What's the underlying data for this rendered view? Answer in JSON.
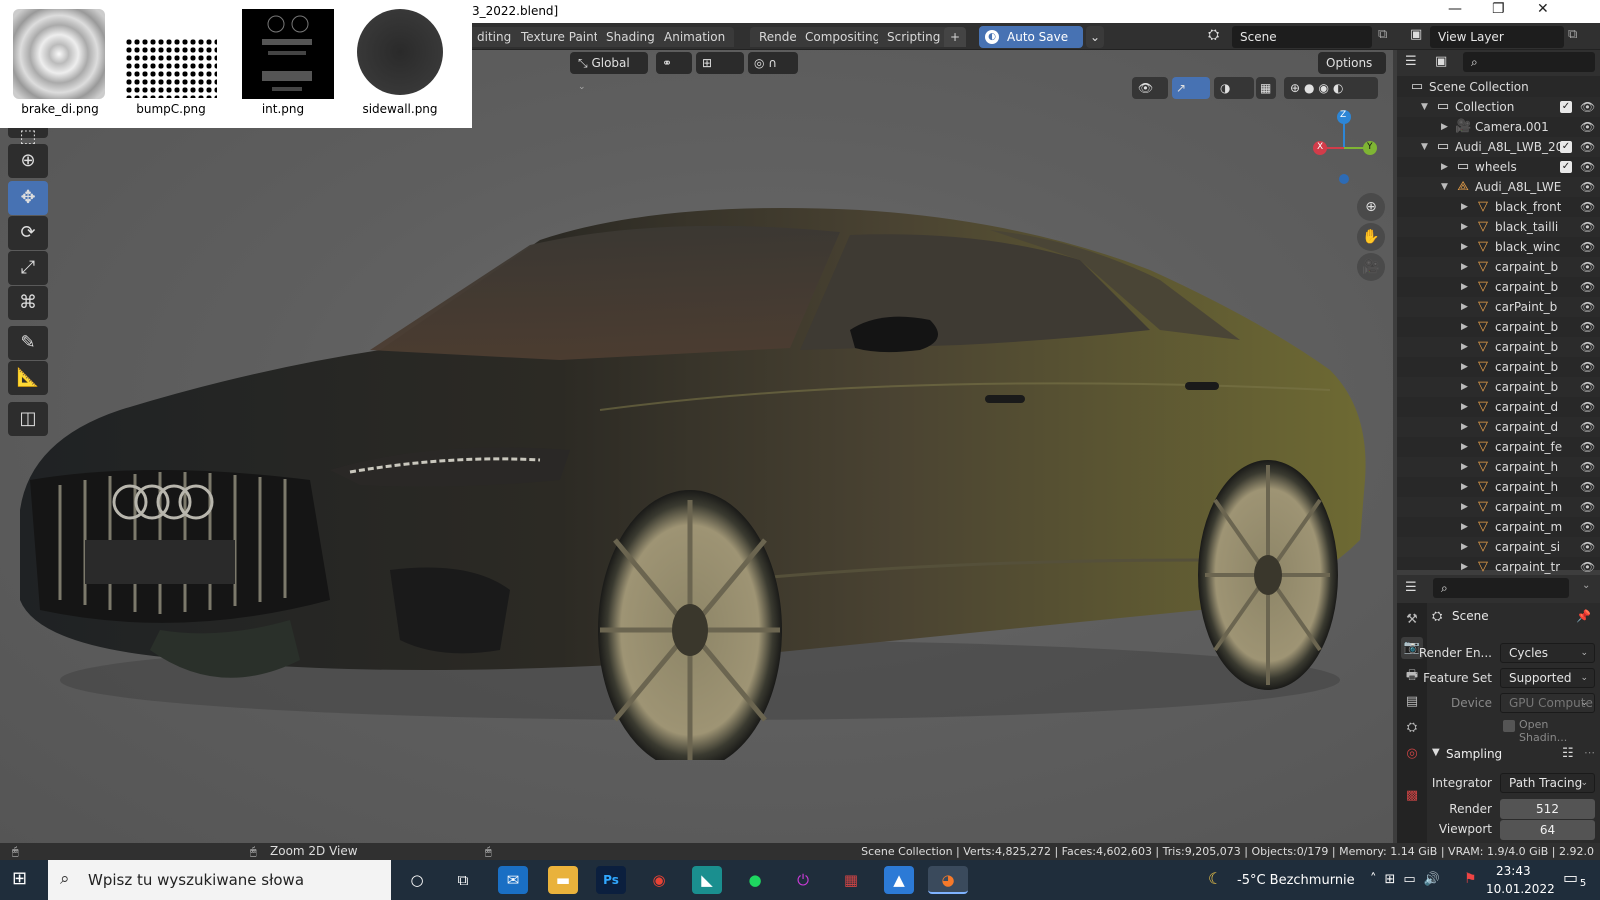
{
  "window": {
    "title": "3_2022.blend]",
    "minimize": "—",
    "maximize": "❐",
    "close": "✕"
  },
  "workspace_tabs": [
    "diting",
    "Texture Paint",
    "Shading",
    "Animation",
    "Rendering",
    "Compositing",
    "Scripting",
    "+"
  ],
  "auto_save": "Auto Save",
  "scene_field": "Scene",
  "view_layer_field": "View Layer",
  "viewport": {
    "transform_orientation": "Global",
    "options": "Options",
    "tool_hint": "Zoom 2D View",
    "gizmo": {
      "x": "X",
      "y": "Y",
      "z": "Z"
    }
  },
  "thumbnails": [
    "brake_di.png",
    "bumpC.png",
    "int.png",
    "sidewall.png"
  ],
  "outliner": {
    "root": "Scene Collection",
    "items": [
      {
        "label": "Collection",
        "depth": 1,
        "icon": "collection-icon",
        "expanded": true,
        "check": true
      },
      {
        "label": "Camera.001",
        "depth": 2,
        "icon": "camera-icon",
        "expanded": false
      },
      {
        "label": "Audi_A8L_LWB_20",
        "depth": 1,
        "icon": "collection-icon",
        "expanded": true,
        "check": true
      },
      {
        "label": "wheels",
        "depth": 2,
        "icon": "collection-icon",
        "expanded": false,
        "check": true
      },
      {
        "label": "Audi_A8L_LWE",
        "depth": 2,
        "icon": "armature-icon",
        "expanded": true
      },
      {
        "label": "black_front",
        "depth": 3,
        "icon": "mesh-icon",
        "expanded": false
      },
      {
        "label": "black_tailli",
        "depth": 3,
        "icon": "mesh-icon",
        "expanded": false
      },
      {
        "label": "black_winc",
        "depth": 3,
        "icon": "mesh-icon",
        "expanded": false
      },
      {
        "label": "carpaint_b",
        "depth": 3,
        "icon": "mesh-icon",
        "expanded": false
      },
      {
        "label": "carpaint_b",
        "depth": 3,
        "icon": "mesh-icon",
        "expanded": false
      },
      {
        "label": "carPaint_b",
        "depth": 3,
        "icon": "mesh-icon",
        "expanded": false
      },
      {
        "label": "carpaint_b",
        "depth": 3,
        "icon": "mesh-icon",
        "expanded": false
      },
      {
        "label": "carpaint_b",
        "depth": 3,
        "icon": "mesh-icon",
        "expanded": false
      },
      {
        "label": "carpaint_b",
        "depth": 3,
        "icon": "mesh-icon",
        "expanded": false
      },
      {
        "label": "carpaint_b",
        "depth": 3,
        "icon": "mesh-icon",
        "expanded": false
      },
      {
        "label": "carpaint_d",
        "depth": 3,
        "icon": "mesh-icon",
        "expanded": false
      },
      {
        "label": "carpaint_d",
        "depth": 3,
        "icon": "mesh-icon",
        "expanded": false
      },
      {
        "label": "carpaint_fe",
        "depth": 3,
        "icon": "mesh-icon",
        "expanded": false
      },
      {
        "label": "carpaint_h",
        "depth": 3,
        "icon": "mesh-icon",
        "expanded": false
      },
      {
        "label": "carpaint_h",
        "depth": 3,
        "icon": "mesh-icon",
        "expanded": false
      },
      {
        "label": "carpaint_m",
        "depth": 3,
        "icon": "mesh-icon",
        "expanded": false
      },
      {
        "label": "carpaint_m",
        "depth": 3,
        "icon": "mesh-icon",
        "expanded": false
      },
      {
        "label": "carpaint_si",
        "depth": 3,
        "icon": "mesh-icon",
        "expanded": false
      },
      {
        "label": "carpaint_tr",
        "depth": 3,
        "icon": "mesh-icon",
        "expanded": false
      }
    ]
  },
  "properties": {
    "context": "Scene",
    "render_engine_label": "Render En...",
    "render_engine": "Cycles",
    "feature_set_label": "Feature Set",
    "feature_set": "Supported",
    "device_label": "Device",
    "device": "GPU Compute",
    "open_shading": "Open Shadin...",
    "sampling": "Sampling",
    "integrator_label": "Integrator",
    "integrator": "Path Tracing",
    "render_label": "Render",
    "render_value": "512",
    "viewport_label": "Viewport",
    "viewport_value": "64"
  },
  "status_bar": "Scene Collection | Verts:4,825,272 | Faces:4,602,603 | Tris:9,205,073 | Objects:0/179 | Memory: 1.14 GiB | VRAM: 1.9/4.0 GiB | 2.92.0",
  "taskbar": {
    "search_placeholder": "Wpisz tu wyszukiwane słowa",
    "weather": "-5°C  Bezchmurnie",
    "time": "23:43",
    "date": "10.01.2022",
    "notifications": "5"
  },
  "colors": {
    "accent": "#4772b3",
    "blender_bg": "#303030",
    "taskbar": "#1f2d3b",
    "mesh_icon": "#e8a04a"
  }
}
